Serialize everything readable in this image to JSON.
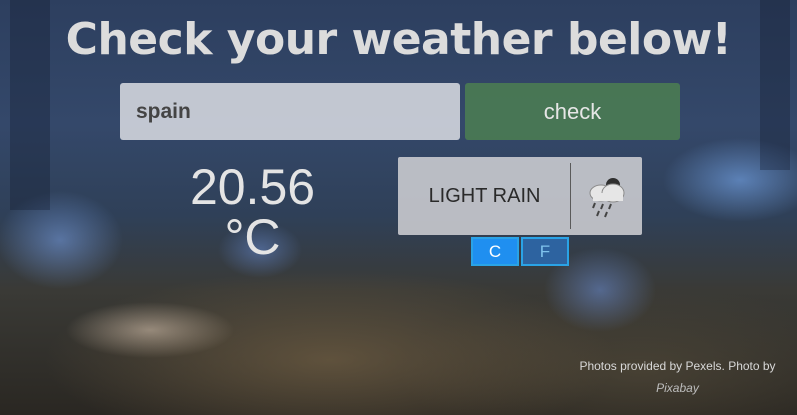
{
  "header": {
    "title": "Check your weather below!"
  },
  "search": {
    "value": "spain",
    "button_label": "check"
  },
  "temperature": {
    "value": "20.56",
    "unit": "°C"
  },
  "condition": {
    "text": "LIGHT RAIN",
    "icon": "rain-cloud-icon"
  },
  "units": {
    "c_label": "C",
    "f_label": "F",
    "selected": "C"
  },
  "footer": {
    "credit_line": "Photos provided by Pexels. Photo by",
    "credit_author": "Pixabay"
  },
  "colors": {
    "check_button": "#4e8250",
    "unit_active": "#1f8ff0",
    "unit_inactive": "#2d63a0",
    "unit_border": "#2aa3e6"
  }
}
